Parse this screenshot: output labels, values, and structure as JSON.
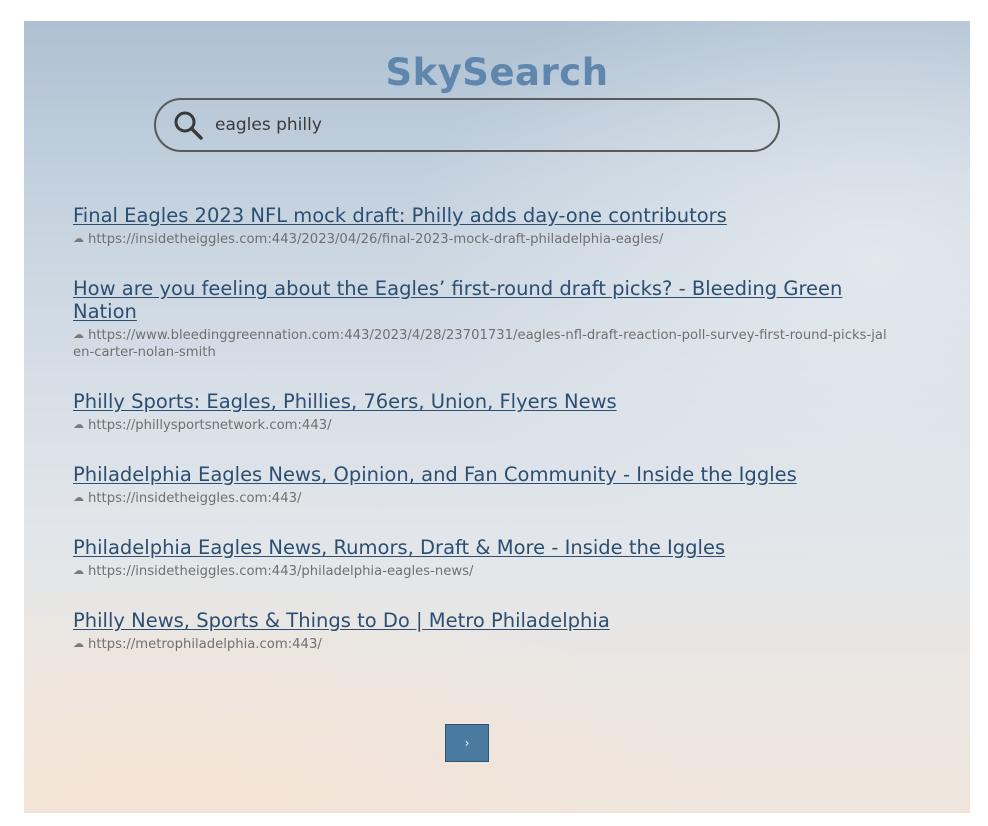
{
  "app": {
    "title": "SkySearch"
  },
  "search": {
    "value": "eagles philly"
  },
  "results": [
    {
      "title": "Final Eagles 2023 NFL mock draft: Philly adds day-one contributors",
      "url": "https://insidetheiggles.com:443/2023/04/26/final-2023-mock-draft-philadelphia-eagles/"
    },
    {
      "title": "How are you feeling about the Eagles’ first-round draft picks? - Bleeding Green Nation",
      "url": "https://www.bleedinggreennation.com:443/2023/4/28/23701731/eagles-nfl-draft-reaction-poll-survey-first-round-picks-jalen-carter-nolan-smith"
    },
    {
      "title": "Philly Sports: Eagles, Phillies, 76ers, Union, Flyers News",
      "url": "https://phillysportsnetwork.com:443/"
    },
    {
      "title": "Philadelphia Eagles News, Opinion, and Fan Community - Inside the Iggles",
      "url": "https://insidetheiggles.com:443/"
    },
    {
      "title": "Philadelphia Eagles News, Rumors, Draft & More - Inside the Iggles",
      "url": "https://insidetheiggles.com:443/philadelphia-eagles-news/"
    },
    {
      "title": "Philly News, Sports & Things to Do | Metro Philadelphia",
      "url": "https://metrophiladelphia.com:443/"
    }
  ],
  "pagination": {
    "next_label": "›"
  },
  "icons": {
    "search": "search-icon",
    "result_marker": "cloud-icon"
  },
  "colors": {
    "brand": "#5f86ac",
    "link": "#2b4e72",
    "button": "#4a7aa0"
  }
}
